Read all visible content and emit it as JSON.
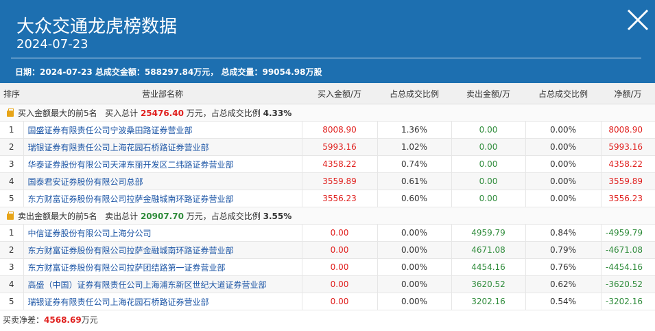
{
  "header": {
    "title": "大众交通龙虎榜数据",
    "date": "2024-07-23",
    "summary": "日期：2024-07-23 总成交金额：588297.84万元， 总成交量：99054.98万股"
  },
  "columns": [
    "排序",
    "营业部名称",
    "买入金额/万",
    "占总成交比例",
    "卖出金额/万",
    "占总成交比例",
    "净额/万"
  ],
  "buy_section": {
    "prefix": "买入金额最大的前5名",
    "total_label": "买入总计",
    "total": "25476.40",
    "unit_text": "万元，占总成交比例",
    "ratio": "4.33%"
  },
  "buy_rows": [
    {
      "rank": "1",
      "name": "国盛证券有限责任公司宁波桑田路证券营业部",
      "buy": "8008.90",
      "buy_pct": "1.36%",
      "sell": "0.00",
      "sell_pct": "0.00%",
      "net": "8008.90"
    },
    {
      "rank": "2",
      "name": "瑞银证券有限责任公司上海花园石桥路证券营业部",
      "buy": "5993.16",
      "buy_pct": "1.02%",
      "sell": "0.00",
      "sell_pct": "0.00%",
      "net": "5993.16"
    },
    {
      "rank": "3",
      "name": "华泰证券股份有限公司天津东丽开发区二纬路证券营业部",
      "buy": "4358.22",
      "buy_pct": "0.74%",
      "sell": "0.00",
      "sell_pct": "0.00%",
      "net": "4358.22"
    },
    {
      "rank": "4",
      "name": "国泰君安证券股份有限公司总部",
      "buy": "3559.89",
      "buy_pct": "0.61%",
      "sell": "0.00",
      "sell_pct": "0.00%",
      "net": "3559.89"
    },
    {
      "rank": "5",
      "name": "东方财富证券股份有限公司拉萨金融城南环路证券营业部",
      "buy": "3556.23",
      "buy_pct": "0.60%",
      "sell": "0.00",
      "sell_pct": "0.00%",
      "net": "3556.23"
    }
  ],
  "sell_section": {
    "prefix": "卖出金额最大的前5名",
    "total_label": "卖出总计",
    "total": "20907.70",
    "unit_text": "万元，占总成交比例",
    "ratio": "3.55%"
  },
  "sell_rows": [
    {
      "rank": "1",
      "name": "中信证券股份有限公司上海分公司",
      "buy": "0.00",
      "buy_pct": "0.00%",
      "sell": "4959.79",
      "sell_pct": "0.84%",
      "net": "-4959.79"
    },
    {
      "rank": "2",
      "name": "东方财富证券股份有限公司拉萨金融城南环路证券营业部",
      "buy": "0.00",
      "buy_pct": "0.00%",
      "sell": "4671.08",
      "sell_pct": "0.79%",
      "net": "-4671.08"
    },
    {
      "rank": "3",
      "name": "东方财富证券股份有限公司拉萨团结路第一证券营业部",
      "buy": "0.00",
      "buy_pct": "0.00%",
      "sell": "4454.16",
      "sell_pct": "0.76%",
      "net": "-4454.16"
    },
    {
      "rank": "4",
      "name": "高盛（中国）证券有限责任公司上海浦东新区世纪大道证券营业部",
      "buy": "0.00",
      "buy_pct": "0.00%",
      "sell": "3620.52",
      "sell_pct": "0.62%",
      "net": "-3620.52"
    },
    {
      "rank": "5",
      "name": "瑞银证券有限责任公司上海花园石桥路证券营业部",
      "buy": "0.00",
      "buy_pct": "0.00%",
      "sell": "3202.16",
      "sell_pct": "0.54%",
      "net": "-3202.16"
    }
  ],
  "footer": {
    "label": "买卖净差：",
    "value": "4568.69",
    "unit": "万元"
  },
  "colors": {
    "header_bg": "#1d6fb0",
    "positive": "#e0201e",
    "negative": "#2e8b3a",
    "link": "#1d56a6"
  },
  "icons": {
    "close": "close-icon",
    "section": "briefcase-icon"
  }
}
